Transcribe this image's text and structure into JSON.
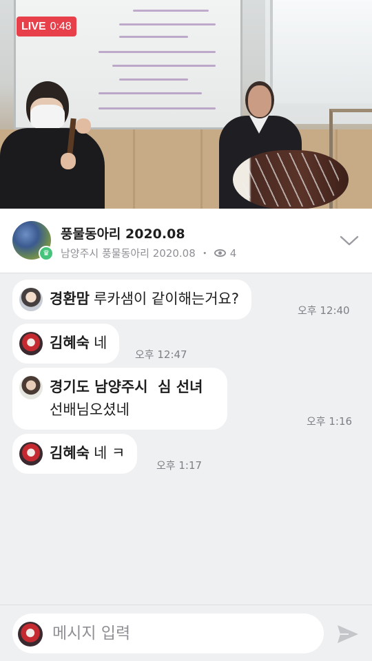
{
  "live": {
    "label": "LIVE",
    "elapsed": "0:48",
    "color": "#e8404b"
  },
  "room": {
    "title": "풍물동아리 2020.08",
    "subtitle": "남양주시 풍물동아리 2020.08",
    "separator": "・",
    "viewer_count": "4"
  },
  "messages": [
    {
      "author": "경환맘",
      "text": "루카샘이 같이해는거요?",
      "time": "오후 12:40"
    },
    {
      "author": "김혜숙",
      "text": "네",
      "time": "오후 12:47"
    },
    {
      "author": "경기도 남양주시  심 선녀",
      "text": "선배님오셨네",
      "time": "오후 1:16"
    },
    {
      "author": "김혜숙",
      "text": "네 ㅋ",
      "time": "오후 1:17"
    }
  ],
  "composer": {
    "placeholder": "메시지 입력"
  },
  "icons": {
    "views": "eye-icon",
    "collapse": "chevron-down-icon",
    "send": "send-icon",
    "host": "crown-icon"
  }
}
